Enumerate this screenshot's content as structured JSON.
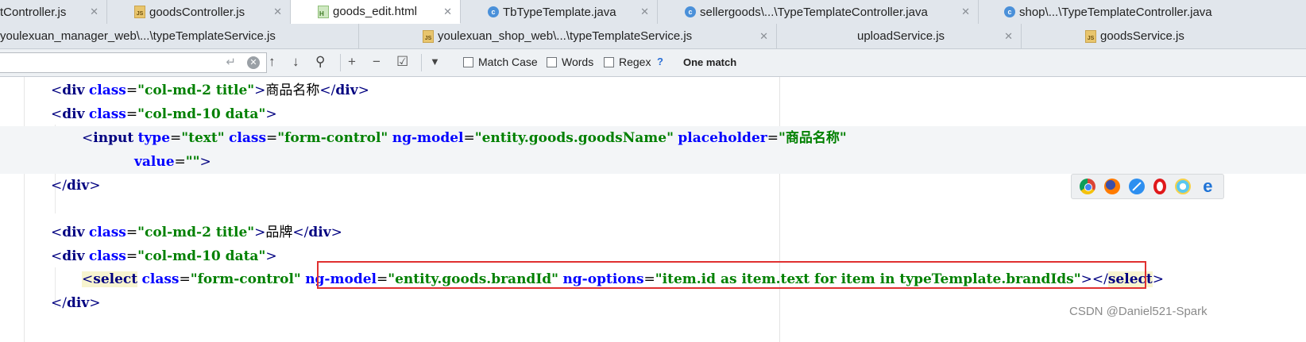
{
  "tabs_row1": [
    {
      "label": "tController.js",
      "icon": "none",
      "active": false
    },
    {
      "label": "goodsController.js",
      "icon": "js",
      "active": false
    },
    {
      "label": "goods_edit.html",
      "icon": "html",
      "active": true
    },
    {
      "label": "TbTypeTemplate.java",
      "icon": "class",
      "active": false
    },
    {
      "label": "sellergoods\\...\\TypeTemplateController.java",
      "icon": "class",
      "active": false
    },
    {
      "label": "shop\\...\\TypeTemplateController.java",
      "icon": "class",
      "active": false
    }
  ],
  "tabs_row2": [
    {
      "label": "youlexuan_manager_web\\...\\typeTemplateService.js",
      "icon": "none"
    },
    {
      "label": "youlexuan_shop_web\\...\\typeTemplateService.js",
      "icon": "js"
    },
    {
      "label": "uploadService.js",
      "icon": "none"
    },
    {
      "label": "goodsService.js",
      "icon": "js"
    }
  ],
  "close_glyph": "✕",
  "find_bar": {
    "search_value": "",
    "enter_glyph": "↵",
    "clear_glyph": "✕",
    "prev_glyph": "↑",
    "next_glyph": "↓",
    "find_all_glyph": "⚲",
    "add_sel_glyph": "+",
    "remove_sel_glyph": "−",
    "select_all_glyph": "☑",
    "filter_glyph": "▼",
    "match_case": "Match Case",
    "words": "Words",
    "regex": "Regex",
    "help": "?",
    "match_status": "One match"
  },
  "code": {
    "l1": {
      "tag": "div",
      "attr": "class",
      "val": "\"col-md-2 title\"",
      "text": "商品名称"
    },
    "l2": {
      "tag": "div",
      "attr": "class",
      "val": "\"col-md-10 data\""
    },
    "l3": {
      "tag": "input",
      "a1": "type",
      "v1": "\"text\"",
      "a2": "class",
      "v2": "\"form-control\"",
      "a3": "ng-model",
      "v3": "\"entity.goods.goodsName\"",
      "a4": "placeholder",
      "v4": "\"商品名称\""
    },
    "l4": {
      "attr": "value",
      "val": "\"\""
    },
    "l5": {
      "tag": "div"
    },
    "l7": {
      "tag": "div",
      "attr": "class",
      "val": "\"col-md-2 title\"",
      "text": "品牌"
    },
    "l8": {
      "tag": "div",
      "attr": "class",
      "val": "\"col-md-10 data\""
    },
    "l9": {
      "tag": "select",
      "a1": "class",
      "v1": "\"form-control\"",
      "a2": "ng-model",
      "v2": "\"entity.goods.brandId\"",
      "a3": "ng-options",
      "v3": "\"item.id as item.text for item in typeTemplate.brandIds\""
    },
    "l10": {
      "tag": "div"
    }
  },
  "browser_icons": [
    "chrome-icon",
    "firefox-icon",
    "safari-icon",
    "opera-icon",
    "ie-icon",
    "edge-icon"
  ],
  "edge_glyph": "e",
  "watermark": "CSDN @Daniel521-Spark"
}
